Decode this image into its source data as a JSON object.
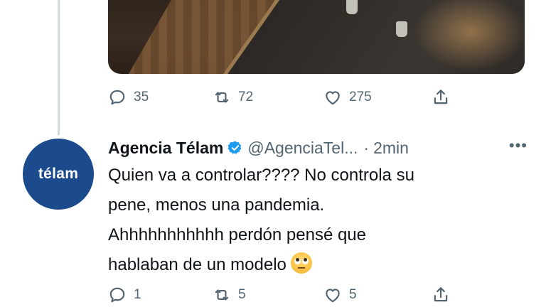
{
  "previous_tweet": {
    "counts": {
      "reply": "35",
      "retweet": "72",
      "like": "275"
    }
  },
  "tweet": {
    "avatar_text": "télam",
    "name": "Agencia Télam",
    "handle": "@AgenciaTel...",
    "separator": "·",
    "time": "2min",
    "more": "•••",
    "lines": [
      "Quien va a controlar???? No controla su",
      "pene, menos una pandemia.",
      "Ahhhhhhhhhhh perdón pensé que",
      "hablaban de un modelo"
    ],
    "counts": {
      "reply": "1",
      "retweet": "5",
      "like": "5"
    }
  },
  "icons": [
    "reply-icon",
    "retweet-icon",
    "like-icon",
    "share-icon",
    "verified-badge-icon",
    "rolling-eyes-emoji"
  ],
  "colors": {
    "muted": "#536471",
    "text": "#0f1419",
    "verified": "#1d9bf0",
    "avatar_bg": "#1b4b8c",
    "thread_line": "#cfd9de"
  }
}
